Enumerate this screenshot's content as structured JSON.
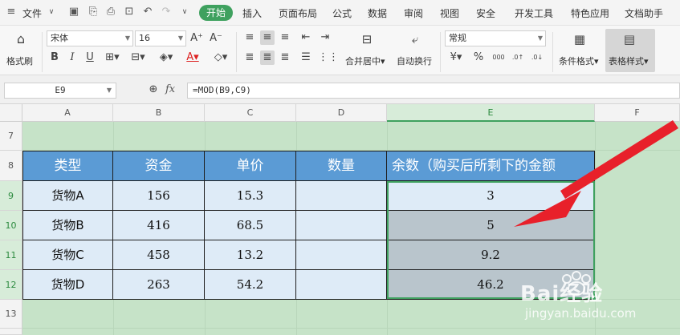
{
  "menu": {
    "file": "文件",
    "tabs": [
      "开始",
      "插入",
      "页面布局",
      "公式",
      "数据",
      "审阅",
      "视图",
      "安全",
      "开发工具",
      "特色应用",
      "文档助手"
    ]
  },
  "ribbon": {
    "format_painter": "格式刷",
    "font_name": "宋体",
    "font_size": "16",
    "merge_center": "合并居中",
    "wrap_text": "自动换行",
    "number_format": "常规",
    "conditional_format": "条件格式",
    "table_style": "表格样式"
  },
  "formula_bar": {
    "name_box": "E9",
    "fx": "fx",
    "formula": "=MOD(B9,C9)"
  },
  "columns": [
    "A",
    "B",
    "C",
    "D",
    "E",
    "F"
  ],
  "rows": [
    "7",
    "8",
    "9",
    "10",
    "11",
    "12",
    "13"
  ],
  "table": {
    "headers": [
      "类型",
      "资金",
      "单价",
      "数量",
      "余数（购买后所剩下的金额"
    ],
    "rows": [
      [
        "货物A",
        "156",
        "15.3",
        "",
        "3"
      ],
      [
        "货物B",
        "416",
        "68.5",
        "",
        "5"
      ],
      [
        "货物C",
        "458",
        "13.2",
        "",
        "9.2"
      ],
      [
        "货物D",
        "263",
        "54.2",
        "",
        "46.2"
      ]
    ]
  },
  "watermark": {
    "brand": "Bai经验",
    "url": "jingyan.baidu.com"
  },
  "colors": {
    "header_fill": "#5b9bd5",
    "data_fill": "#deebf7",
    "selected_fill": "#b9c5cc",
    "sheet_bg": "#c6e3c8",
    "accent_green": "#3fa15f",
    "arrow_red": "#e8202a"
  }
}
